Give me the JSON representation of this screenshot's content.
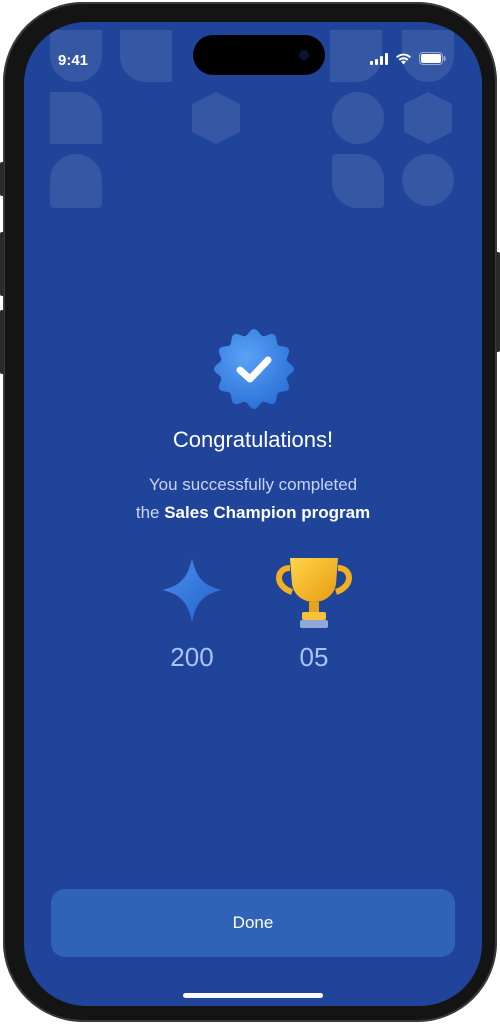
{
  "status_bar": {
    "time": "9:41",
    "icons": [
      "signal-icon",
      "wifi-icon",
      "battery-icon"
    ]
  },
  "badge": {
    "icon": "verified-check-badge-icon",
    "color": "#3a86e8"
  },
  "title": "Congratulations!",
  "subtitle": {
    "line1": "You successfully completed",
    "prefix": "the",
    "program": "Sales Champion program"
  },
  "stats": [
    {
      "icon": "sparkle-star-icon",
      "value": "200"
    },
    {
      "icon": "trophy-icon",
      "value": "05"
    }
  ],
  "done_button": {
    "label": "Done"
  },
  "colors": {
    "background": "#1f449a",
    "button": "#2f63b8",
    "accent": "#3a86e8",
    "trophy": "#f3b51f"
  }
}
